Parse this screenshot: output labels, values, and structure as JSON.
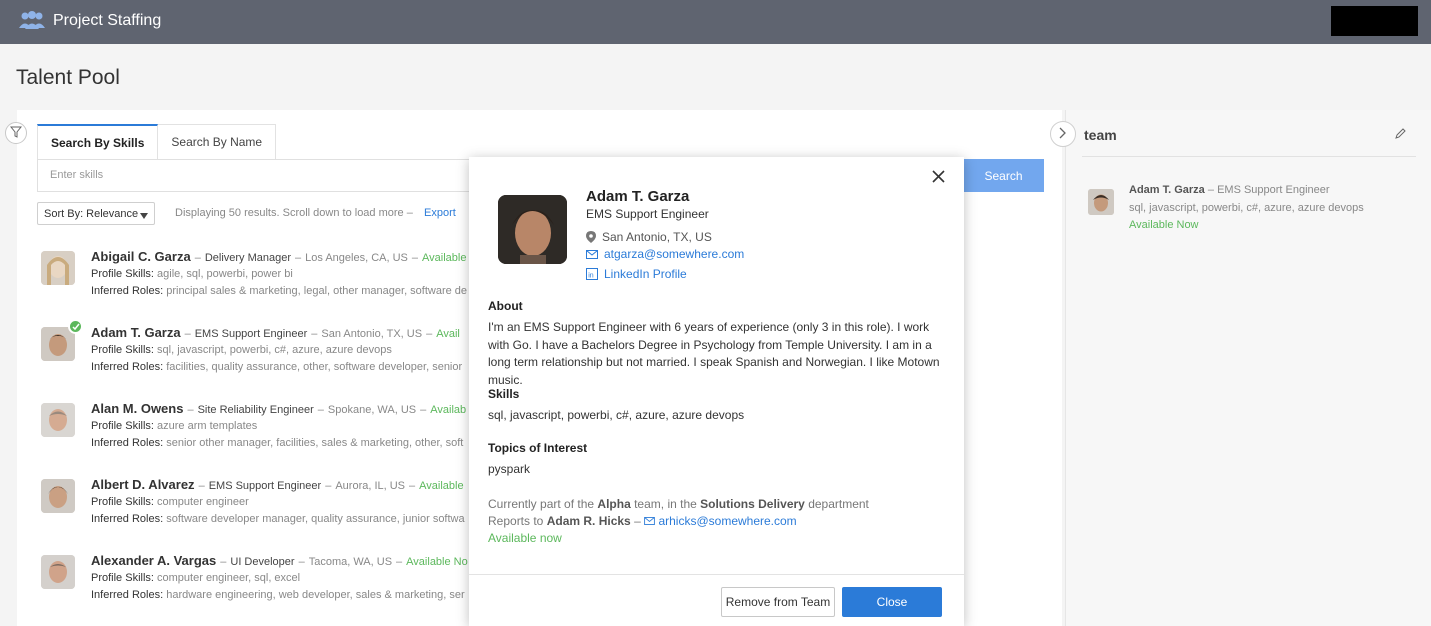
{
  "app": {
    "title": "Project Staffing"
  },
  "page": {
    "title": "Talent Pool"
  },
  "search": {
    "tabs": [
      {
        "label": "Search By Skills"
      },
      {
        "label": "Search By Name"
      }
    ],
    "placeholder": "Enter skills",
    "button": "Search",
    "sort_label": "Sort By: Relevance",
    "results_text": "Displaying 50 results. Scroll down to load more",
    "export": "Export"
  },
  "results": [
    {
      "name": "Abigail C. Garza",
      "role": "Delivery Manager",
      "location": "Los Angeles, CA, US",
      "availability": "Available",
      "profile_skills": "agile, sql, powerbi, power bi",
      "inferred_roles": "principal sales & marketing, legal, other manager, software de",
      "selected": false
    },
    {
      "name": "Adam T. Garza",
      "role": "EMS Support Engineer",
      "location": "San Antonio, TX, US",
      "availability": "Avail",
      "profile_skills": "sql, javascript, powerbi, c#, azure, azure devops",
      "inferred_roles": "facilities, quality assurance, other, software developer, senior",
      "selected": true
    },
    {
      "name": "Alan M. Owens",
      "role": "Site Reliability Engineer",
      "location": "Spokane, WA, US",
      "availability": "Availab",
      "profile_skills": "azure arm templates",
      "inferred_roles": "senior other manager, facilities, sales & marketing, other, soft",
      "selected": false
    },
    {
      "name": "Albert D. Alvarez",
      "role": "EMS Support Engineer",
      "location": "Aurora, IL, US",
      "availability": "Available",
      "profile_skills": "computer engineer",
      "inferred_roles": "software developer manager, quality assurance, junior softwa",
      "selected": false
    },
    {
      "name": "Alexander A. Vargas",
      "role": "UI Developer",
      "location": "Tacoma, WA, US",
      "availability": "Available No",
      "profile_skills": "computer engineer, sql, excel",
      "inferred_roles": "hardware engineering, web developer, sales & marketing, ser",
      "selected": false
    }
  ],
  "labels": {
    "profile_skills": "Profile Skills:",
    "inferred_roles": "Inferred Roles:",
    "sep": "–"
  },
  "team": {
    "title": "team",
    "members": [
      {
        "name": "Adam T. Garza",
        "role": "EMS Support Engineer",
        "skills": "sql, javascript, powerbi, c#, azure, azure devops",
        "availability": "Available Now"
      }
    ]
  },
  "modal": {
    "name": "Adam T. Garza",
    "title": "EMS Support Engineer",
    "location": "San Antonio, TX, US",
    "email": "atgarza@somewhere.com",
    "linkedin": "LinkedIn Profile",
    "about_heading": "About",
    "about": "I'm an EMS Support Engineer with 6 years of experience (only 3 in this role). I work with Go. I have a Bachelors Degree in Psychology from Temple University. I am in a long term relationship but not married. I speak Spanish and Norwegian. I like Motown music.",
    "skills_heading": "Skills",
    "skills": "sql, javascript, powerbi, c#, azure, azure devops",
    "topics_heading": "Topics of Interest",
    "topics": "pyspark",
    "team_prefix": "Currently part of the",
    "team_name": "Alpha",
    "team_mid": "team, in the",
    "department": "Solutions Delivery",
    "department_suffix": "department",
    "reports_prefix": "Reports to",
    "manager": "Adam R. Hicks",
    "manager_email": "arhicks@somewhere.com",
    "availability": "Available now",
    "remove_button": "Remove from Team",
    "close_button": "Close"
  },
  "colors": {
    "accent": "#2b7bd8",
    "available": "#5cb85c",
    "topbar": "#5f6470"
  }
}
